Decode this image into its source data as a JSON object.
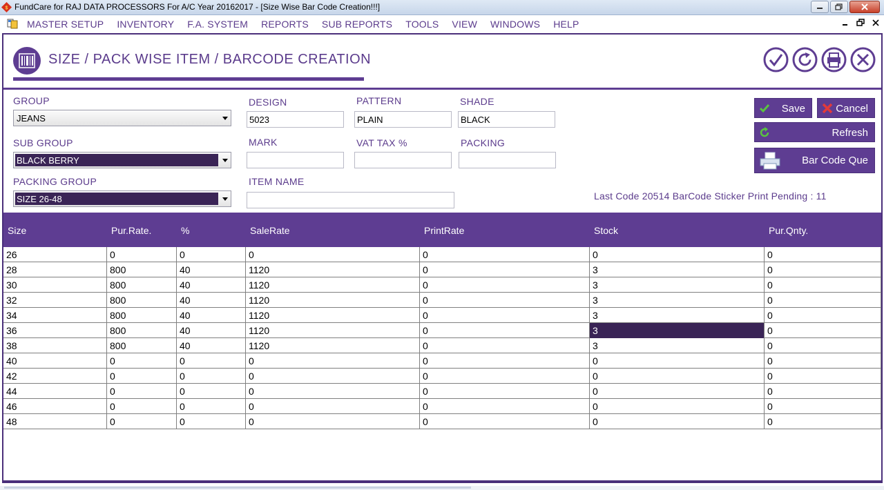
{
  "window": {
    "title": "FundCare  for RAJ DATA PROCESSORS For A/C Year 20162017 - [Size Wise Bar Code Creation!!!]"
  },
  "menu": {
    "items": [
      "MASTER SETUP",
      "INVENTORY",
      "F.A. SYSTEM",
      "REPORTS",
      "SUB REPORTS",
      "TOOLS",
      "VIEW",
      "WINDOWS",
      "HELP"
    ]
  },
  "header": {
    "title": "SIZE / PACK WISE ITEM / BARCODE CREATION",
    "icons": [
      "barcode-icon",
      "check-icon",
      "refresh-icon",
      "printer-icon",
      "close-icon"
    ]
  },
  "form": {
    "group": {
      "label": "GROUP",
      "value": "JEANS"
    },
    "sub_group": {
      "label": "SUB GROUP",
      "value": "BLACK BERRY"
    },
    "packing_group": {
      "label": "PACKING GROUP",
      "value": "SIZE 26-48"
    },
    "design": {
      "label": "DESIGN",
      "value": "5023"
    },
    "pattern": {
      "label": "PATTERN",
      "value": "PLAIN"
    },
    "shade": {
      "label": "SHADE",
      "value": "BLACK"
    },
    "mark": {
      "label": "MARK",
      "value": ""
    },
    "vat": {
      "label": "VAT TAX %",
      "value": ""
    },
    "packing": {
      "label": "PACKING",
      "value": ""
    },
    "item_name": {
      "label": "ITEM NAME",
      "value": ""
    }
  },
  "buttons": {
    "save": "Save",
    "cancel": "Cancel",
    "refresh": "Refresh",
    "barcode_que": "Bar Code Que"
  },
  "status": "Last Code 20514 BarCode Sticker Print Pending : 11",
  "colors": {
    "accent": "#5e3d92",
    "selection": "#3a2456",
    "label_text": "#5b3b8c"
  },
  "grid": {
    "columns": [
      "Size",
      "Pur.Rate.",
      "%",
      "SaleRate",
      "PrintRate",
      "Stock",
      "Pur.Qnty."
    ],
    "rows": [
      [
        "26",
        "0",
        "0",
        "0",
        "0",
        "0",
        "0"
      ],
      [
        "28",
        "800",
        "40",
        "1120",
        "0",
        "3",
        "0"
      ],
      [
        "30",
        "800",
        "40",
        "1120",
        "0",
        "3",
        "0"
      ],
      [
        "32",
        "800",
        "40",
        "1120",
        "0",
        "3",
        "0"
      ],
      [
        "34",
        "800",
        "40",
        "1120",
        "0",
        "3",
        "0"
      ],
      [
        "36",
        "800",
        "40",
        "1120",
        "0",
        "3",
        "0"
      ],
      [
        "38",
        "800",
        "40",
        "1120",
        "0",
        "3",
        "0"
      ],
      [
        "40",
        "0",
        "0",
        "0",
        "0",
        "0",
        "0"
      ],
      [
        "42",
        "0",
        "0",
        "0",
        "0",
        "0",
        "0"
      ],
      [
        "44",
        "0",
        "0",
        "0",
        "0",
        "0",
        "0"
      ],
      [
        "46",
        "0",
        "0",
        "0",
        "0",
        "0",
        "0"
      ],
      [
        "48",
        "0",
        "0",
        "0",
        "0",
        "0",
        "0"
      ]
    ],
    "selected_cell": {
      "row": 5,
      "col": 5
    }
  }
}
